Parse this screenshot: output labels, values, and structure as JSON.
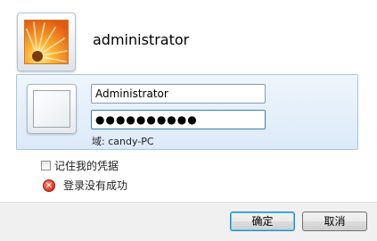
{
  "account": {
    "name": "administrator"
  },
  "credential": {
    "username_value": "Administrator",
    "password_value": "●●●●●●●●●●",
    "domain_text": "域: candy-PC"
  },
  "options": {
    "remember_label": "记住我的凭据",
    "error_text": "登录没有成功"
  },
  "buttons": {
    "ok": "确定",
    "cancel": "取消"
  }
}
